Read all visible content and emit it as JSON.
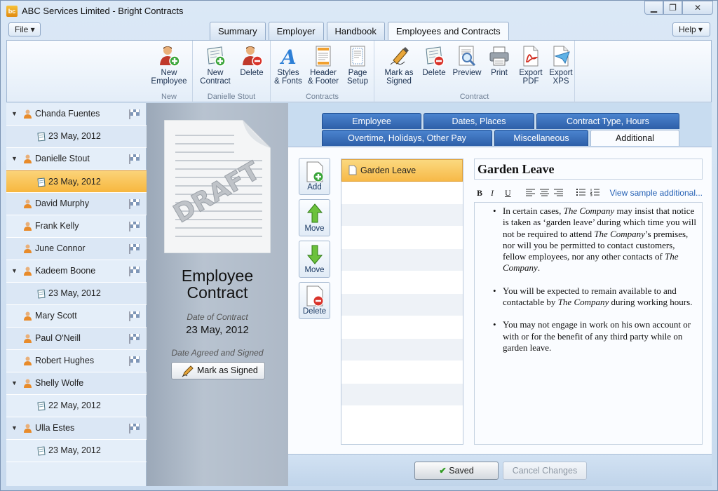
{
  "window": {
    "title": "ABC Services Limited - Bright Contracts",
    "app_icon": "bc"
  },
  "menu": {
    "file_label": "File ▾",
    "help_label": "Help ▾"
  },
  "tabs": [
    {
      "label": "Summary"
    },
    {
      "label": "Employer"
    },
    {
      "label": "Handbook"
    },
    {
      "label": "Employees and Contracts",
      "active": true
    }
  ],
  "ribbon": {
    "groups": [
      {
        "label": "New",
        "buttons": [
          {
            "label1": "New",
            "label2": "Employee",
            "icon": "new-employee-icon"
          }
        ]
      },
      {
        "label": "Danielle Stout",
        "buttons": [
          {
            "label1": "New",
            "label2": "Contract",
            "icon": "new-contract-icon"
          },
          {
            "label1": "Delete",
            "label2": "",
            "icon": "delete-person-icon"
          }
        ]
      },
      {
        "label": "Contracts",
        "buttons": [
          {
            "label1": "Styles",
            "label2": "& Fonts",
            "icon": "styles-icon"
          },
          {
            "label1": "Header",
            "label2": "& Footer",
            "icon": "header-footer-icon"
          },
          {
            "label1": "Page",
            "label2": "Setup",
            "icon": "page-setup-icon"
          }
        ]
      },
      {
        "label": "Contract",
        "buttons": [
          {
            "label1": "Mark as",
            "label2": "Signed",
            "icon": "pen-icon"
          },
          {
            "label1": "Delete",
            "label2": "",
            "icon": "delete-doc-icon"
          },
          {
            "label1": "Preview",
            "label2": "",
            "icon": "preview-icon"
          },
          {
            "label1": "Print",
            "label2": "",
            "icon": "printer-icon"
          },
          {
            "label1": "Export",
            "label2": "PDF",
            "icon": "pdf-icon"
          },
          {
            "label1": "Export",
            "label2": "XPS",
            "icon": "xps-icon"
          }
        ]
      }
    ]
  },
  "sidebar": {
    "items": [
      {
        "type": "person",
        "label": "Chanda Fuentes",
        "expanded": true
      },
      {
        "type": "contract",
        "label": "23 May, 2012"
      },
      {
        "type": "person",
        "label": "Danielle Stout",
        "expanded": true
      },
      {
        "type": "contract",
        "label": "23 May, 2012",
        "selected": true
      },
      {
        "type": "person",
        "label": "David Murphy"
      },
      {
        "type": "person",
        "label": "Frank Kelly"
      },
      {
        "type": "person",
        "label": "June Connor"
      },
      {
        "type": "person",
        "label": "Kadeem Boone",
        "expanded": true
      },
      {
        "type": "contract",
        "label": "23 May, 2012"
      },
      {
        "type": "person",
        "label": "Mary Scott"
      },
      {
        "type": "person",
        "label": "Paul O'Neill"
      },
      {
        "type": "person",
        "label": "Robert Hughes"
      },
      {
        "type": "person",
        "label": "Shelly Wolfe",
        "expanded": true
      },
      {
        "type": "contract",
        "label": "22 May, 2012"
      },
      {
        "type": "person",
        "label": "Ulla Estes",
        "expanded": true
      },
      {
        "type": "contract",
        "label": "23 May, 2012"
      }
    ]
  },
  "document": {
    "stamp": "DRAFT",
    "title_line1": "Employee",
    "title_line2": "Contract",
    "date_label": "Date of Contract",
    "date_value": "23 May, 2012",
    "signed_label": "Date Agreed and Signed",
    "mark_signed_label": "Mark as Signed"
  },
  "inner_tabs": {
    "row1": [
      "Employee",
      "Dates, Places",
      "Contract Type, Hours"
    ],
    "row2": [
      "Overtime, Holidays, Other Pay",
      "Miscellaneous",
      "Additional"
    ],
    "active": "Additional"
  },
  "side_buttons": {
    "add": "Add",
    "move_up": "Move",
    "move_down": "Move",
    "delete": "Delete"
  },
  "clauses": {
    "selected": "Garden Leave"
  },
  "editor": {
    "title": "Garden Leave",
    "toolbar": {
      "bold": "B",
      "italic": "I",
      "underline": "U",
      "view_link": "View sample additional..."
    },
    "paragraphs": [
      {
        "t1": "In certain cases, ",
        "c1": "The Company",
        "t2": " may insist that notice is taken as ‘garden leave’ during which time you will not be required to attend ",
        "c2": "The Company",
        "t3": "’s premises, nor will you be permitted to contact customers, fellow employees, nor any other contacts of ",
        "c3": "The Company",
        "t4": "."
      },
      {
        "t1": "You will be expected to remain available to and contactable by ",
        "c1": "The Company",
        "t2": " during working hours."
      },
      {
        "t1": "You may not engage in work on his own account or with or for the benefit of any third party while on garden leave."
      }
    ]
  },
  "footer": {
    "saved_label": "Saved",
    "cancel_label": "Cancel Changes"
  }
}
